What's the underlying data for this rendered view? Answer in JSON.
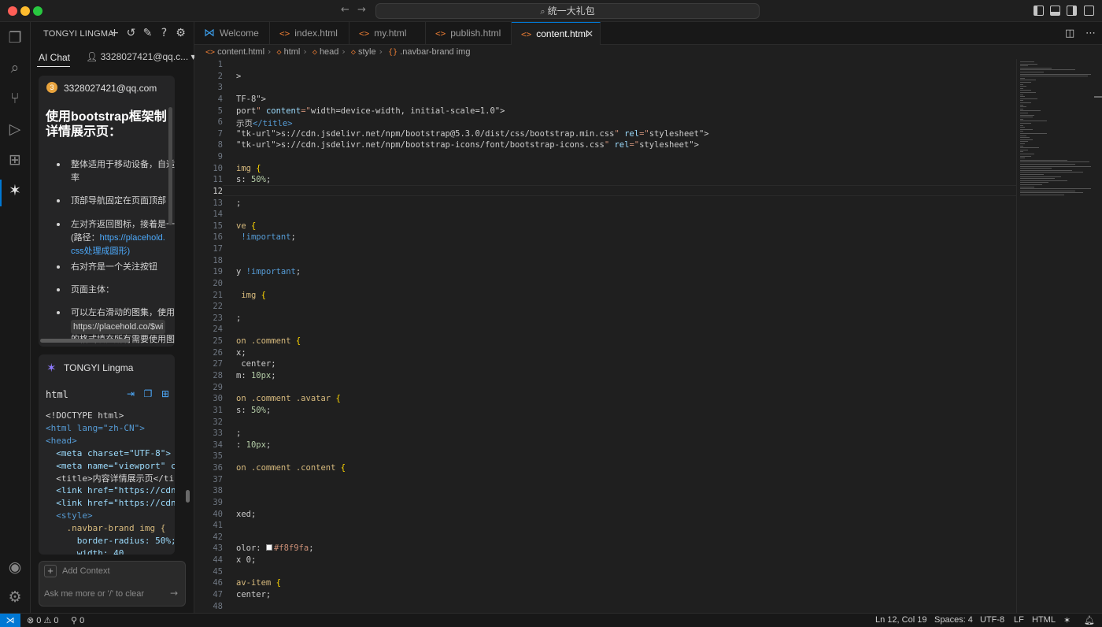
{
  "titlebar": {
    "search": "统一大礼包",
    "back_icon": "arrow-left-icon",
    "forward_icon": "arrow-right-icon"
  },
  "activity": {
    "items": [
      "explorer-icon",
      "search-icon",
      "source-control-icon",
      "run-debug-icon",
      "extensions-icon",
      "tongyi-lingma-icon"
    ],
    "bottom": [
      "account-icon",
      "manage-gear-icon"
    ]
  },
  "side": {
    "title": "TONGYI LINGMA",
    "tab": "AI Chat",
    "user_select": "3328027421@qq.c...",
    "user_card": {
      "avatar_letter": "3",
      "user": "3328027421@qq.com",
      "title_line1": "使用bootstrap框架制",
      "title_line2": "详情展示页：",
      "bullets": [
        {
          "a": "整体适用于移动设备，自适",
          "b": "率"
        },
        {
          "a": "顶部导航固定在页面顶部"
        },
        {
          "a": "左对齐返回图标，接着是一",
          "b_pre": "(路径：",
          "b_link": "https://placehold.",
          "c": "css处理成圆形)"
        },
        {
          "a": "右对齐是一个关注按钮"
        },
        {
          "a": "页面主体："
        },
        {
          "a": "可以左右滑动的图集，使用",
          "b_chip": "https://placehold.co/$wi",
          "c": "的格式填充所有需要使用图"
        }
      ]
    },
    "ai_card": {
      "name": "TONGYI Lingma",
      "lang": "html",
      "code": [
        "<!DOCTYPE html>",
        "<html lang=\"zh-CN\">",
        "<head>",
        "  <meta charset=\"UTF-8\">",
        "  <meta name=\"viewport\" c",
        "  <title>内容详情展示页</ti",
        "  <link href=\"https://cdn",
        "  <link href=\"https://cdn",
        "  <style>",
        "    .navbar-brand img {",
        "      border-radius: 50%;",
        "      width: 40"
      ]
    },
    "input": {
      "add_context": "Add Context",
      "placeholder": "Ask me more or '/' to clear"
    }
  },
  "editor": {
    "tabs": [
      {
        "label": "Welcome",
        "icon": "vscode-icon"
      },
      {
        "label": "index.html",
        "icon": "html-icon"
      },
      {
        "label": "my.html",
        "icon": "html-icon"
      },
      {
        "label": "publish.html",
        "icon": "html-icon"
      },
      {
        "label": "content.html",
        "icon": "html-icon",
        "active": true
      }
    ],
    "breadcrumbs": [
      "content.html",
      "html",
      "head",
      "style",
      ".navbar-brand img"
    ],
    "lines": [
      {
        "n": "1",
        "t": ""
      },
      {
        "n": "2",
        "t": ">"
      },
      {
        "n": "3",
        "t": ""
      },
      {
        "n": "4",
        "t": "TF-8\">"
      },
      {
        "n": "5",
        "t": "port\" content=\"width=device-width, initial-scale=1.0\">"
      },
      {
        "n": "6",
        "t": "示页</title>"
      },
      {
        "n": "7",
        "t": "s://cdn.jsdelivr.net/npm/bootstrap@5.3.0/dist/css/bootstrap.min.css\" rel=\"stylesheet\">"
      },
      {
        "n": "8",
        "t": "s://cdn.jsdelivr.net/npm/bootstrap-icons/font/bootstrap-icons.css\" rel=\"stylesheet\">"
      },
      {
        "n": "9",
        "t": ""
      },
      {
        "n": "10",
        "t": "img {"
      },
      {
        "n": "11",
        "t": "s: 50%;"
      },
      {
        "n": "12",
        "t": ""
      },
      {
        "n": "13",
        "t": ";"
      },
      {
        "n": "14",
        "t": ""
      },
      {
        "n": "15",
        "t": "ve {"
      },
      {
        "n": "16",
        "t": " !important;"
      },
      {
        "n": "17",
        "t": ""
      },
      {
        "n": "18",
        "t": ""
      },
      {
        "n": "19",
        "t": "y !important;"
      },
      {
        "n": "20",
        "t": ""
      },
      {
        "n": "21",
        "t": " img {"
      },
      {
        "n": "22",
        "t": ""
      },
      {
        "n": "23",
        "t": ";"
      },
      {
        "n": "24",
        "t": ""
      },
      {
        "n": "25",
        "t": "on .comment {"
      },
      {
        "n": "26",
        "t": "x;"
      },
      {
        "n": "27",
        "t": " center;"
      },
      {
        "n": "28",
        "t": "m: 10px;"
      },
      {
        "n": "29",
        "t": ""
      },
      {
        "n": "30",
        "t": "on .comment .avatar {"
      },
      {
        "n": "31",
        "t": "s: 50%;"
      },
      {
        "n": "32",
        "t": ""
      },
      {
        "n": "33",
        "t": ";"
      },
      {
        "n": "34",
        "t": ": 10px;"
      },
      {
        "n": "35",
        "t": ""
      },
      {
        "n": "36",
        "t": "on .comment .content {"
      },
      {
        "n": "37",
        "t": ""
      },
      {
        "n": "38",
        "t": ""
      },
      {
        "n": "39",
        "t": ""
      },
      {
        "n": "40",
        "t": "xed;"
      },
      {
        "n": "41",
        "t": ""
      },
      {
        "n": "42",
        "t": ""
      },
      {
        "n": "43",
        "t": "olor: #f8f9fa;"
      },
      {
        "n": "44",
        "t": "x 0;"
      },
      {
        "n": "45",
        "t": ""
      },
      {
        "n": "46",
        "t": "av-item {"
      },
      {
        "n": "47",
        "t": "center;"
      },
      {
        "n": "48",
        "t": ""
      }
    ],
    "current_line": "12"
  },
  "status": {
    "errors": "0",
    "warnings": "0",
    "ports": "0",
    "position": "Ln 12, Col 19",
    "spaces": "Spaces: 4",
    "encoding": "UTF-8",
    "eol": "LF",
    "language": "HTML"
  },
  "colors": {
    "accent": "#0078d4",
    "html_icon": "#e37933",
    "link": "#4daafc"
  }
}
